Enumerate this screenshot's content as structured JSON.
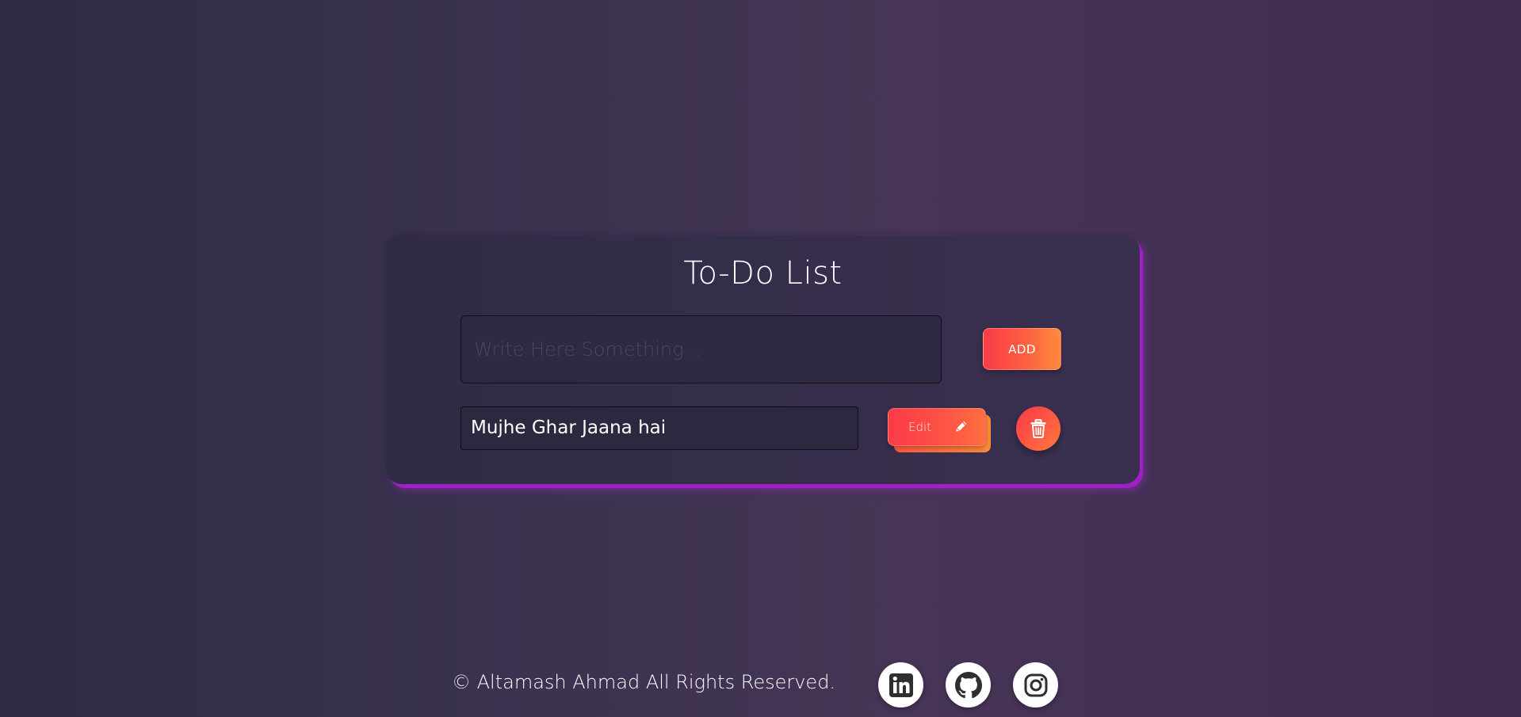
{
  "app": {
    "title": "To-Do List"
  },
  "new_task": {
    "placeholder": "Write Here Something...",
    "value": "",
    "add_label": "ADD"
  },
  "todos": [
    {
      "text": "Mujhe Ghar Jaana hai",
      "edit_label": "Edit",
      "edit_icon": "pencil-icon",
      "delete_icon": "trash-icon"
    }
  ],
  "footer": {
    "copyright": "© Altamash Ahmad All Rights Reserved.",
    "social_links": [
      {
        "name": "LinkedIn",
        "icon": "linkedin-icon"
      },
      {
        "name": "GitHub",
        "icon": "github-icon"
      },
      {
        "name": "Instagram",
        "icon": "instagram-icon"
      }
    ]
  },
  "colors": {
    "accent_start": "#fb3b48",
    "accent_end": "#fe8a3c",
    "card_glow": "#a020c8",
    "background": "#3b3350"
  }
}
